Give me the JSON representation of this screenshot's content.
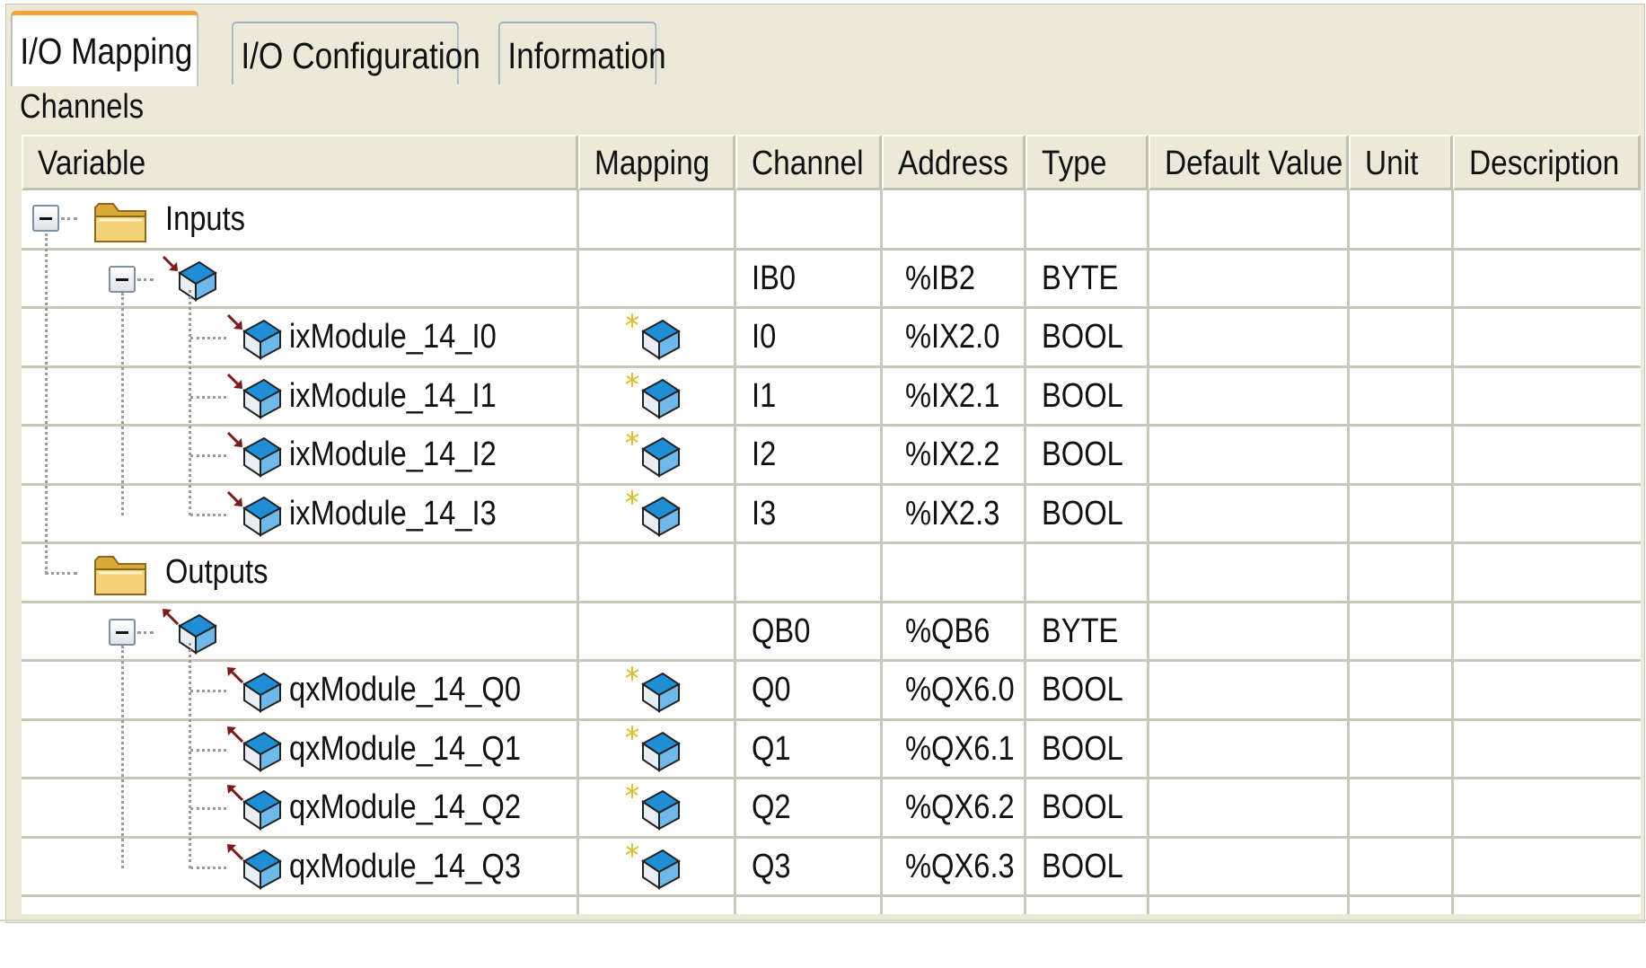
{
  "tabs": [
    {
      "label": "I/O Mapping",
      "active": true
    },
    {
      "label": "I/O Configuration",
      "active": false
    },
    {
      "label": "Information",
      "active": false
    }
  ],
  "section_title": "Channels",
  "columns": [
    "Variable",
    "Mapping",
    "Channel",
    "Address",
    "Type",
    "Default Value",
    "Unit",
    "Description"
  ],
  "rows": [
    {
      "kind": "folder",
      "label": "Inputs",
      "level": 0,
      "expanded": true,
      "channel": "",
      "address": "",
      "type": ""
    },
    {
      "kind": "group",
      "direction": "input",
      "label": "",
      "level": 1,
      "expanded": true,
      "channel": "IB0",
      "address": "%IB2",
      "type": "BYTE"
    },
    {
      "kind": "channel",
      "direction": "input",
      "label": "ixModule_14_I0",
      "level": 2,
      "mapped": true,
      "channel": "I0",
      "address": "%IX2.0",
      "type": "BOOL"
    },
    {
      "kind": "channel",
      "direction": "input",
      "label": "ixModule_14_I1",
      "level": 2,
      "mapped": true,
      "channel": "I1",
      "address": "%IX2.1",
      "type": "BOOL"
    },
    {
      "kind": "channel",
      "direction": "input",
      "label": "ixModule_14_I2",
      "level": 2,
      "mapped": true,
      "channel": "I2",
      "address": "%IX2.2",
      "type": "BOOL"
    },
    {
      "kind": "channel",
      "direction": "input",
      "label": "ixModule_14_I3",
      "level": 2,
      "mapped": true,
      "channel": "I3",
      "address": "%IX2.3",
      "type": "BOOL"
    },
    {
      "kind": "folder",
      "label": "Outputs",
      "level": 0,
      "expanded": true,
      "channel": "",
      "address": "",
      "type": ""
    },
    {
      "kind": "group",
      "direction": "output",
      "label": "",
      "level": 1,
      "expanded": true,
      "channel": "QB0",
      "address": "%QB6",
      "type": "BYTE"
    },
    {
      "kind": "channel",
      "direction": "output",
      "label": "qxModule_14_Q0",
      "level": 2,
      "mapped": true,
      "channel": "Q0",
      "address": "%QX6.0",
      "type": "BOOL"
    },
    {
      "kind": "channel",
      "direction": "output",
      "label": "qxModule_14_Q1",
      "level": 2,
      "mapped": true,
      "channel": "Q1",
      "address": "%QX6.1",
      "type": "BOOL"
    },
    {
      "kind": "channel",
      "direction": "output",
      "label": "qxModule_14_Q2",
      "level": 2,
      "mapped": true,
      "channel": "Q2",
      "address": "%QX6.2",
      "type": "BOOL"
    },
    {
      "kind": "channel",
      "direction": "output",
      "label": "qxModule_14_Q3",
      "level": 2,
      "mapped": true,
      "channel": "Q3",
      "address": "%QX6.3",
      "type": "BOOL"
    }
  ],
  "colors": {
    "panel": "#ece9d8",
    "active_tab_accent": "#f2a33a",
    "grid_line": "#c9c6ba",
    "cube_blue": "#1e8fd6",
    "arrow_dark_red": "#7a1a1a",
    "folder_yellow": "#f3d27a"
  },
  "icons": {
    "folder": "folder-icon",
    "io_channel": "io-channel-icon",
    "mapping": "mapping-icon",
    "expander": "collapse-icon"
  }
}
